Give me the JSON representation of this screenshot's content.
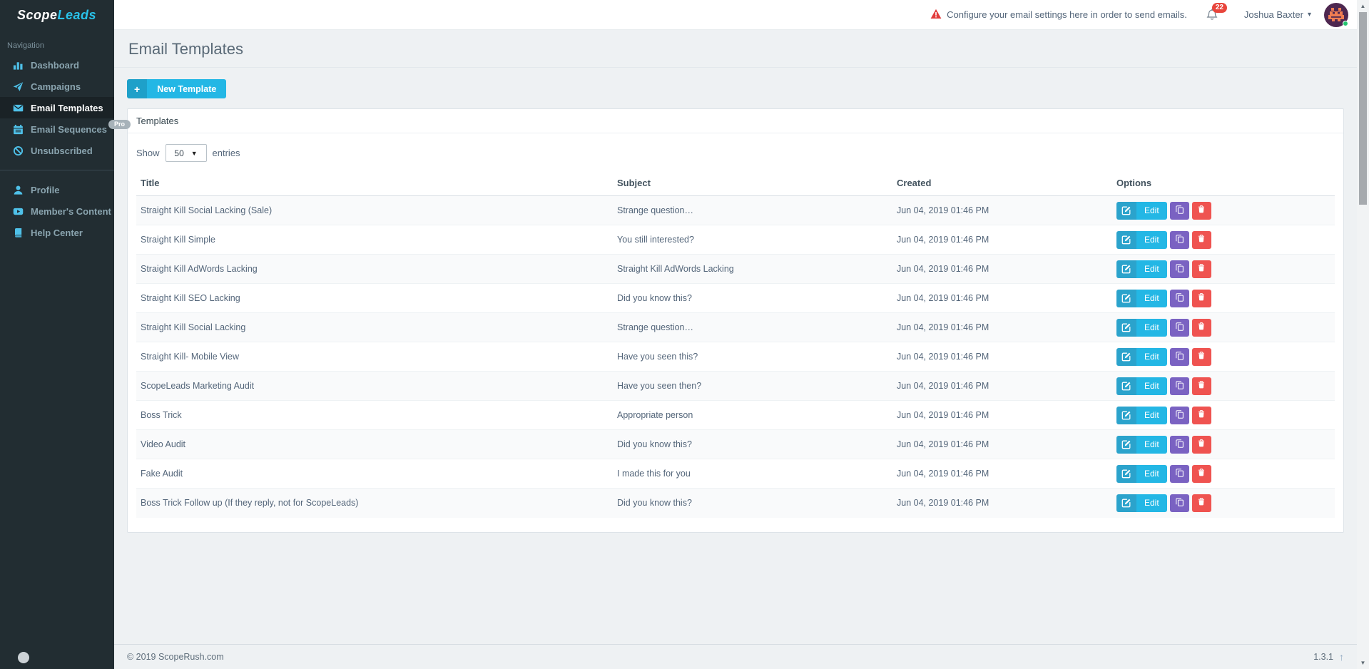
{
  "sidebar": {
    "logo_part1": "Scope",
    "logo_part2": "Leads",
    "section_label": "Navigation",
    "items": [
      {
        "label": "Dashboard",
        "icon": "bar-chart-icon",
        "active": false
      },
      {
        "label": "Campaigns",
        "icon": "paper-plane-icon",
        "active": false
      },
      {
        "label": "Email Templates",
        "icon": "envelope-icon",
        "active": true
      },
      {
        "label": "Email Sequences",
        "icon": "calendar-icon",
        "active": false,
        "badge": "Pro"
      },
      {
        "label": "Unsubscribed",
        "icon": "ban-icon",
        "active": false
      }
    ],
    "items_secondary": [
      {
        "label": "Profile",
        "icon": "user-icon"
      },
      {
        "label": "Member's Content",
        "icon": "play-icon"
      },
      {
        "label": "Help Center",
        "icon": "book-icon"
      }
    ]
  },
  "topbar": {
    "warning": "Configure your email settings here in order to send emails.",
    "notification_count": "22",
    "user_name": "Joshua Baxter"
  },
  "page": {
    "title": "Email Templates"
  },
  "toolbar": {
    "new_template_label": "New Template"
  },
  "panel": {
    "title": "Templates",
    "show_label": "Show",
    "entries_label": "entries",
    "page_size": "50",
    "table": {
      "headers": {
        "title": "Title",
        "subject": "Subject",
        "created": "Created",
        "options": "Options"
      },
      "edit_label": "Edit",
      "rows": [
        {
          "title": "Straight Kill Social Lacking (Sale)",
          "subject": "Strange question…",
          "created": "Jun 04, 2019 01:46 PM"
        },
        {
          "title": "Straight Kill Simple",
          "subject": "You still interested?",
          "created": "Jun 04, 2019 01:46 PM"
        },
        {
          "title": "Straight Kill AdWords Lacking",
          "subject": "Straight Kill AdWords Lacking",
          "created": "Jun 04, 2019 01:46 PM"
        },
        {
          "title": "Straight Kill SEO Lacking",
          "subject": "Did you know this?",
          "created": "Jun 04, 2019 01:46 PM"
        },
        {
          "title": "Straight Kill Social Lacking",
          "subject": "Strange question…",
          "created": "Jun 04, 2019 01:46 PM"
        },
        {
          "title": "Straight Kill- Mobile View",
          "subject": "Have you seen this?",
          "created": "Jun 04, 2019 01:46 PM"
        },
        {
          "title": "ScopeLeads Marketing Audit",
          "subject": "Have you seen then?",
          "created": "Jun 04, 2019 01:46 PM"
        },
        {
          "title": "Boss Trick",
          "subject": "Appropriate person",
          "created": "Jun 04, 2019 01:46 PM"
        },
        {
          "title": "Video Audit",
          "subject": "Did you know this?",
          "created": "Jun 04, 2019 01:46 PM"
        },
        {
          "title": "Fake Audit",
          "subject": "I made this for you",
          "created": "Jun 04, 2019 01:46 PM"
        },
        {
          "title": "Boss Trick Follow up (If they reply, not for ScopeLeads)",
          "subject": "Did you know this?",
          "created": "Jun 04, 2019 01:46 PM"
        }
      ]
    }
  },
  "footer": {
    "copyright": "© 2019  ScopeRush.com",
    "version": "1.3.1"
  },
  "colors": {
    "sidebar_bg": "#222d32",
    "sidebar_active_bg": "#1a2226",
    "sidebar_icon_blue": "#4fc1e9",
    "accent_cyan": "#23b7e5",
    "accent_cyan_dark": "#2ba3cc",
    "purple": "#7a62c2",
    "red": "#ef5350",
    "badge_red": "#e8453c",
    "warning_triangle": "#e23c3c",
    "avatar_bg": "#4e2750",
    "avatar_fg": "#f07d52",
    "online_green": "#24c46f"
  }
}
